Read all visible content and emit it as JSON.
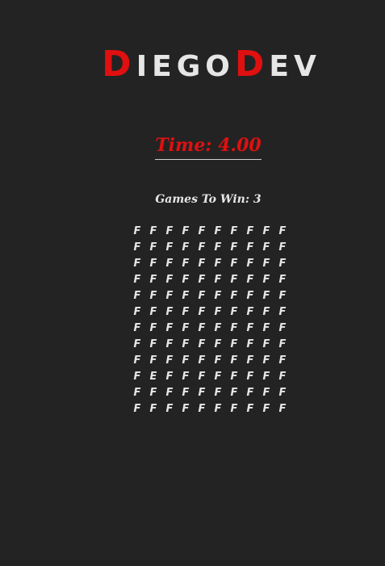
{
  "logo": {
    "first_initial": "D",
    "first_rest": "IEGO",
    "second_initial": "D",
    "second_rest": "EV"
  },
  "timer": {
    "label": "Time: 4.00"
  },
  "games_to_win": {
    "label": "Games To Win: 3"
  },
  "grid": {
    "columns": 10,
    "rows": 12,
    "cells": [
      [
        "F",
        "F",
        "F",
        "F",
        "F",
        "F",
        "F",
        "F",
        "F",
        "F"
      ],
      [
        "F",
        "F",
        "F",
        "F",
        "F",
        "F",
        "F",
        "F",
        "F",
        "F"
      ],
      [
        "F",
        "F",
        "F",
        "F",
        "F",
        "F",
        "F",
        "F",
        "F",
        "F"
      ],
      [
        "F",
        "F",
        "F",
        "F",
        "F",
        "F",
        "F",
        "F",
        "F",
        "F"
      ],
      [
        "F",
        "F",
        "F",
        "F",
        "F",
        "F",
        "F",
        "F",
        "F",
        "F"
      ],
      [
        "F",
        "F",
        "F",
        "F",
        "F",
        "F",
        "F",
        "F",
        "F",
        "F"
      ],
      [
        "F",
        "F",
        "F",
        "F",
        "F",
        "F",
        "F",
        "F",
        "F",
        "F"
      ],
      [
        "F",
        "F",
        "F",
        "F",
        "F",
        "F",
        "F",
        "F",
        "F",
        "F"
      ],
      [
        "F",
        "F",
        "F",
        "F",
        "F",
        "F",
        "F",
        "F",
        "F",
        "F"
      ],
      [
        "F",
        "E",
        "F",
        "F",
        "F",
        "F",
        "F",
        "F",
        "F",
        "F"
      ],
      [
        "F",
        "F",
        "F",
        "F",
        "F",
        "F",
        "F",
        "F",
        "F",
        "F"
      ],
      [
        "F",
        "F",
        "F",
        "F",
        "F",
        "F",
        "F",
        "F",
        "F",
        "F"
      ]
    ]
  },
  "colors": {
    "background": "#232323",
    "accent": "#e01010",
    "text": "#e6e6e6"
  }
}
